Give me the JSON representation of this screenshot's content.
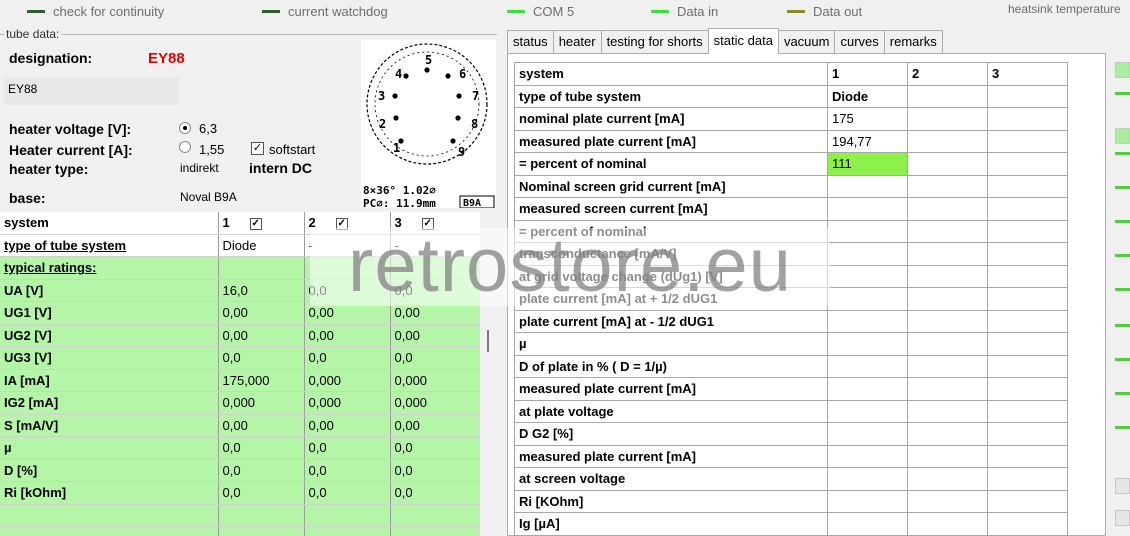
{
  "topbar": {
    "indicators": [
      {
        "label": "check for continuity",
        "color": "#2f5e2f"
      },
      {
        "label": "current watchdog",
        "color": "#2f5e2f"
      },
      {
        "label": "COM 5",
        "color": "#38e038"
      },
      {
        "label": "Data in",
        "color": "#38e038"
      },
      {
        "label": "Data out",
        "color": "#8a8a2a"
      }
    ],
    "heatsink_label": "heatsink temperature"
  },
  "tube": {
    "legend": "tube data:",
    "designation_label": "designation:",
    "designation_value": "EY88",
    "name_field": "EY88",
    "heater_voltage_label": "heater voltage [V]:",
    "heater_voltage_value": "6,3",
    "heater_current_label": "Heater current [A]:",
    "heater_current_value": "1,55",
    "softstart_label": "softstart",
    "heater_type_label": "heater type:",
    "heater_type_value": "indirekt",
    "heater_supply": "intern DC",
    "base_label": "base:",
    "base_value": "Noval B9A",
    "pin_numbers": [
      "1",
      "2",
      "3",
      "4",
      "5",
      "6",
      "7",
      "8",
      "9"
    ],
    "dims_line1": "8×36° 1.02⌀",
    "dims_line2": "PC⌀: 11.9mm",
    "base_code": "B9A"
  },
  "left_table": {
    "header": [
      "system",
      "1",
      "2",
      "3"
    ],
    "type_row": [
      "type of tube system",
      "Diode",
      "-",
      "-"
    ],
    "section_label": "typical ratings:",
    "rows": [
      {
        "label": "UA [V]",
        "v": [
          "16,0",
          "0,0",
          "0,0"
        ]
      },
      {
        "label": "UG1 [V]",
        "v": [
          "0,00",
          "0,00",
          "0,00"
        ]
      },
      {
        "label": "UG2 [V]",
        "v": [
          "0,00",
          "0,00",
          "0,00"
        ]
      },
      {
        "label": "UG3 [V]",
        "v": [
          "0,0",
          "0,0",
          "0,0"
        ]
      },
      {
        "label": "IA [mA]",
        "v": [
          "175,000",
          "0,000",
          "0,000"
        ]
      },
      {
        "label": "IG2 [mA]",
        "v": [
          "0,000",
          "0,000",
          "0,000"
        ]
      },
      {
        "label": "S [mA/V]",
        "v": [
          "0,00",
          "0,00",
          "0,00"
        ]
      },
      {
        "label": "µ",
        "v": [
          "0,0",
          "0,0",
          "0,0"
        ]
      },
      {
        "label": "D [%]",
        "v": [
          "0,0",
          "0,0",
          "0,0"
        ]
      },
      {
        "label": "Ri [kOhm]",
        "v": [
          "0,0",
          "0,0",
          "0,0"
        ]
      }
    ]
  },
  "tabs": [
    "status",
    "heater",
    "testing for shorts",
    "static data",
    "vacuum",
    "curves",
    "remarks"
  ],
  "active_tab": "static data",
  "static_table": {
    "header": [
      "system",
      "1",
      "2",
      "3"
    ],
    "highlight_color": "#8ef04b",
    "rows": [
      {
        "label": "type of tube system",
        "v": [
          "Diode",
          "",
          ""
        ]
      },
      {
        "label": "nominal plate current [mA]",
        "v": [
          "175",
          "",
          ""
        ]
      },
      {
        "label": "measured plate current [mA]",
        "v": [
          "194,77",
          "",
          ""
        ]
      },
      {
        "label": "= percent of nominal",
        "v": [
          "111",
          "",
          ""
        ]
      },
      {
        "label": "Nominal screen grid current [mA]",
        "v": [
          "",
          "",
          ""
        ]
      },
      {
        "label": "measured screen current [mA]",
        "v": [
          "",
          "",
          ""
        ]
      },
      {
        "label": "= percent of nominal",
        "v": [
          "",
          "",
          ""
        ]
      },
      {
        "label": "transconductance [mA/V]",
        "v": [
          "",
          "",
          ""
        ]
      },
      {
        "label": "at grid voltage change (dUg1) [V]",
        "v": [
          "",
          "",
          ""
        ]
      },
      {
        "label": "plate current [mA] at + 1/2 dUG1",
        "v": [
          "",
          "",
          ""
        ]
      },
      {
        "label": "plate current [mA] at - 1/2 dUG1",
        "v": [
          "",
          "",
          ""
        ]
      },
      {
        "label": "µ",
        "v": [
          "",
          "",
          ""
        ]
      },
      {
        "label": "D of plate in % ( D = 1/µ)",
        "v": [
          "",
          "",
          ""
        ]
      },
      {
        "label": "measured plate current [mA]",
        "v": [
          "",
          "",
          ""
        ]
      },
      {
        "label": "at plate voltage",
        "v": [
          "",
          "",
          ""
        ]
      },
      {
        "label": "D G2 [%]",
        "v": [
          "",
          "",
          ""
        ]
      },
      {
        "label": "measured plate current [mA]",
        "v": [
          "",
          "",
          ""
        ]
      },
      {
        "label": "at screen voltage",
        "v": [
          "",
          "",
          ""
        ]
      },
      {
        "label": "Ri [KOhm]",
        "v": [
          "",
          "",
          ""
        ]
      },
      {
        "label": "Ig [µA]",
        "v": [
          "",
          "",
          ""
        ]
      }
    ]
  },
  "watermark": "retrostore.eu"
}
